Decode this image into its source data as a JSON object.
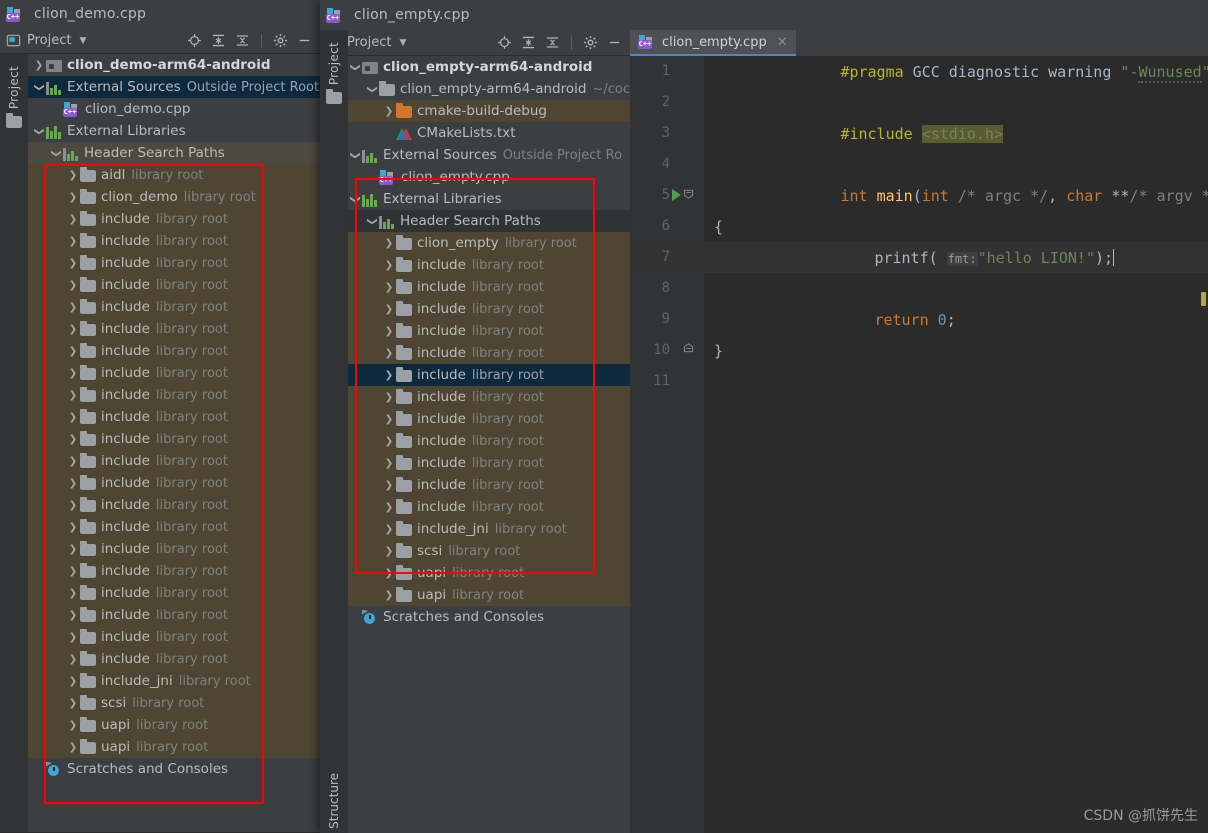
{
  "window_left": {
    "title": "clion_demo.cpp",
    "title_icon": "cpp-file-icon",
    "toolwindow": {
      "label": "Project",
      "caret_icon": "chevron-down-icon",
      "icons": [
        "locate-icon",
        "expand-all-icon",
        "collapse-all-icon",
        "gear-icon",
        "minimize-icon"
      ],
      "vertical_tab": "Project"
    },
    "tree": [
      {
        "indent": 0,
        "arrow": "chevron-right",
        "icon": "module-icon",
        "name": "clion_demo-arm64-android",
        "sub": "",
        "bold": true,
        "state": ""
      },
      {
        "indent": 0,
        "arrow": "chevron-down",
        "icon": "sources-icon",
        "name": "External Sources",
        "sub": "Outside Project Root",
        "bold": false,
        "state": "sel-blue"
      },
      {
        "indent": 1,
        "arrow": "none",
        "icon": "cpp-file-icon",
        "name": "clion_demo.cpp",
        "sub": "",
        "bold": false,
        "state": ""
      },
      {
        "indent": 0,
        "arrow": "chevron-down",
        "icon": "libs-icon",
        "name": "External Libraries",
        "sub": "",
        "bold": false,
        "state": ""
      },
      {
        "indent": 1,
        "arrow": "chevron-down",
        "icon": "sources-icon",
        "name": "Header Search Paths",
        "sub": "",
        "bold": false,
        "state": "hdr-sel"
      },
      {
        "indent": 2,
        "arrow": "chevron-right",
        "icon": "folder-icon",
        "name": "aidl",
        "sub": "library root",
        "bold": false,
        "state": "sel-olive"
      },
      {
        "indent": 2,
        "arrow": "chevron-right",
        "icon": "folder-icon",
        "name": "clion_demo",
        "sub": "library root",
        "bold": false,
        "state": "sel-olive"
      },
      {
        "indent": 2,
        "arrow": "chevron-right",
        "icon": "folder-icon",
        "name": "include",
        "sub": "library root",
        "bold": false,
        "state": "sel-olive"
      },
      {
        "indent": 2,
        "arrow": "chevron-right",
        "icon": "folder-icon",
        "name": "include",
        "sub": "library root",
        "bold": false,
        "state": "sel-olive"
      },
      {
        "indent": 2,
        "arrow": "chevron-right",
        "icon": "folder-icon",
        "name": "include",
        "sub": "library root",
        "bold": false,
        "state": "sel-olive"
      },
      {
        "indent": 2,
        "arrow": "chevron-right",
        "icon": "folder-icon",
        "name": "include",
        "sub": "library root",
        "bold": false,
        "state": "sel-olive"
      },
      {
        "indent": 2,
        "arrow": "chevron-right",
        "icon": "folder-icon",
        "name": "include",
        "sub": "library root",
        "bold": false,
        "state": "sel-olive"
      },
      {
        "indent": 2,
        "arrow": "chevron-right",
        "icon": "folder-icon",
        "name": "include",
        "sub": "library root",
        "bold": false,
        "state": "sel-olive"
      },
      {
        "indent": 2,
        "arrow": "chevron-right",
        "icon": "folder-icon",
        "name": "include",
        "sub": "library root",
        "bold": false,
        "state": "sel-olive"
      },
      {
        "indent": 2,
        "arrow": "chevron-right",
        "icon": "folder-icon",
        "name": "include",
        "sub": "library root",
        "bold": false,
        "state": "sel-olive"
      },
      {
        "indent": 2,
        "arrow": "chevron-right",
        "icon": "folder-icon",
        "name": "include",
        "sub": "library root",
        "bold": false,
        "state": "sel-olive"
      },
      {
        "indent": 2,
        "arrow": "chevron-right",
        "icon": "folder-icon",
        "name": "include",
        "sub": "library root",
        "bold": false,
        "state": "sel-olive"
      },
      {
        "indent": 2,
        "arrow": "chevron-right",
        "icon": "folder-icon",
        "name": "include",
        "sub": "library root",
        "bold": false,
        "state": "sel-olive"
      },
      {
        "indent": 2,
        "arrow": "chevron-right",
        "icon": "folder-icon",
        "name": "include",
        "sub": "library root",
        "bold": false,
        "state": "sel-olive"
      },
      {
        "indent": 2,
        "arrow": "chevron-right",
        "icon": "folder-icon",
        "name": "include",
        "sub": "library root",
        "bold": false,
        "state": "sel-olive"
      },
      {
        "indent": 2,
        "arrow": "chevron-right",
        "icon": "folder-icon",
        "name": "include",
        "sub": "library root",
        "bold": false,
        "state": "sel-olive"
      },
      {
        "indent": 2,
        "arrow": "chevron-right",
        "icon": "folder-icon",
        "name": "include",
        "sub": "library root",
        "bold": false,
        "state": "sel-olive"
      },
      {
        "indent": 2,
        "arrow": "chevron-right",
        "icon": "folder-icon",
        "name": "include",
        "sub": "library root",
        "bold": false,
        "state": "sel-olive"
      },
      {
        "indent": 2,
        "arrow": "chevron-right",
        "icon": "folder-icon",
        "name": "include",
        "sub": "library root",
        "bold": false,
        "state": "sel-olive"
      },
      {
        "indent": 2,
        "arrow": "chevron-right",
        "icon": "folder-icon",
        "name": "include",
        "sub": "library root",
        "bold": false,
        "state": "sel-olive"
      },
      {
        "indent": 2,
        "arrow": "chevron-right",
        "icon": "folder-icon",
        "name": "include",
        "sub": "library root",
        "bold": false,
        "state": "sel-olive"
      },
      {
        "indent": 2,
        "arrow": "chevron-right",
        "icon": "folder-icon",
        "name": "include",
        "sub": "library root",
        "bold": false,
        "state": "sel-olive"
      },
      {
        "indent": 2,
        "arrow": "chevron-right",
        "icon": "folder-icon",
        "name": "include",
        "sub": "library root",
        "bold": false,
        "state": "sel-olive"
      },
      {
        "indent": 2,
        "arrow": "chevron-right",
        "icon": "folder-icon",
        "name": "include_jni",
        "sub": "library root",
        "bold": false,
        "state": "sel-olive"
      },
      {
        "indent": 2,
        "arrow": "chevron-right",
        "icon": "folder-icon",
        "name": "scsi",
        "sub": "library root",
        "bold": false,
        "state": "sel-olive"
      },
      {
        "indent": 2,
        "arrow": "chevron-right",
        "icon": "folder-icon",
        "name": "uapi",
        "sub": "library root",
        "bold": false,
        "state": "sel-olive"
      },
      {
        "indent": 2,
        "arrow": "chevron-right",
        "icon": "folder-icon",
        "name": "uapi",
        "sub": "library root",
        "bold": false,
        "state": "sel-olive"
      },
      {
        "indent": 0,
        "arrow": "none",
        "icon": "scratches-icon",
        "name": "Scratches and Consoles",
        "sub": "",
        "bold": false,
        "state": ""
      }
    ],
    "highlight_box": {
      "label": "header-search-paths-highlight"
    }
  },
  "window_right": {
    "title": "clion_empty.cpp",
    "title_icon": "cpp-file-icon",
    "toolwindow": {
      "label": "Project",
      "caret_icon": "chevron-down-icon",
      "icons": [
        "locate-icon",
        "expand-all-icon",
        "collapse-all-icon",
        "gear-icon",
        "minimize-icon"
      ],
      "vertical_tab": "Project",
      "vertical_tab_bottom": "Structure"
    },
    "tree": [
      {
        "indent": 0,
        "arrow": "chevron-down",
        "icon": "module-icon",
        "name": "clion_empty-arm64-android",
        "sub": "",
        "bold": true,
        "state": ""
      },
      {
        "indent": 1,
        "arrow": "chevron-down",
        "icon": "folder-icon",
        "name": "clion_empty-arm64-android",
        "sub": "~/coc",
        "bold": false,
        "state": ""
      },
      {
        "indent": 2,
        "arrow": "chevron-right",
        "icon": "folder-orange-icon",
        "name": "cmake-build-debug",
        "sub": "",
        "bold": false,
        "state": "sel-olive"
      },
      {
        "indent": 2,
        "arrow": "none",
        "icon": "cmake-icon",
        "name": "CMakeLists.txt",
        "sub": "",
        "bold": false,
        "state": ""
      },
      {
        "indent": 0,
        "arrow": "chevron-down",
        "icon": "sources-icon",
        "name": "External Sources",
        "sub": "Outside Project Ro",
        "bold": false,
        "state": ""
      },
      {
        "indent": 1,
        "arrow": "none",
        "icon": "cpp-file-icon",
        "name": "clion_empty.cpp",
        "sub": "",
        "bold": false,
        "state": ""
      },
      {
        "indent": 0,
        "arrow": "chevron-down",
        "icon": "libs-icon",
        "name": "External Libraries",
        "sub": "",
        "bold": false,
        "state": ""
      },
      {
        "indent": 1,
        "arrow": "chevron-down",
        "icon": "sources-icon",
        "name": "Header Search Paths",
        "sub": "",
        "bold": false,
        "state": "sel-dark"
      },
      {
        "indent": 2,
        "arrow": "chevron-right",
        "icon": "folder-icon",
        "name": "clion_empty",
        "sub": "library root",
        "bold": false,
        "state": "sel-olive"
      },
      {
        "indent": 2,
        "arrow": "chevron-right",
        "icon": "folder-icon",
        "name": "include",
        "sub": "library root",
        "bold": false,
        "state": "sel-olive"
      },
      {
        "indent": 2,
        "arrow": "chevron-right",
        "icon": "folder-icon",
        "name": "include",
        "sub": "library root",
        "bold": false,
        "state": "sel-olive"
      },
      {
        "indent": 2,
        "arrow": "chevron-right",
        "icon": "folder-icon",
        "name": "include",
        "sub": "library root",
        "bold": false,
        "state": "sel-olive"
      },
      {
        "indent": 2,
        "arrow": "chevron-right",
        "icon": "folder-icon",
        "name": "include",
        "sub": "library root",
        "bold": false,
        "state": "sel-olive"
      },
      {
        "indent": 2,
        "arrow": "chevron-right",
        "icon": "folder-icon",
        "name": "include",
        "sub": "library root",
        "bold": false,
        "state": "sel-olive"
      },
      {
        "indent": 2,
        "arrow": "chevron-right",
        "icon": "folder-icon",
        "name": "include",
        "sub": "library root",
        "bold": false,
        "state": "sel-blue"
      },
      {
        "indent": 2,
        "arrow": "chevron-right",
        "icon": "folder-icon",
        "name": "include",
        "sub": "library root",
        "bold": false,
        "state": "sel-olive"
      },
      {
        "indent": 2,
        "arrow": "chevron-right",
        "icon": "folder-icon",
        "name": "include",
        "sub": "library root",
        "bold": false,
        "state": "sel-olive"
      },
      {
        "indent": 2,
        "arrow": "chevron-right",
        "icon": "folder-icon",
        "name": "include",
        "sub": "library root",
        "bold": false,
        "state": "sel-olive"
      },
      {
        "indent": 2,
        "arrow": "chevron-right",
        "icon": "folder-icon",
        "name": "include",
        "sub": "library root",
        "bold": false,
        "state": "sel-olive"
      },
      {
        "indent": 2,
        "arrow": "chevron-right",
        "icon": "folder-icon",
        "name": "include",
        "sub": "library root",
        "bold": false,
        "state": "sel-olive"
      },
      {
        "indent": 2,
        "arrow": "chevron-right",
        "icon": "folder-icon",
        "name": "include",
        "sub": "library root",
        "bold": false,
        "state": "sel-olive"
      },
      {
        "indent": 2,
        "arrow": "chevron-right",
        "icon": "folder-icon",
        "name": "include_jni",
        "sub": "library root",
        "bold": false,
        "state": "sel-olive"
      },
      {
        "indent": 2,
        "arrow": "chevron-right",
        "icon": "folder-icon",
        "name": "scsi",
        "sub": "library root",
        "bold": false,
        "state": "sel-olive"
      },
      {
        "indent": 2,
        "arrow": "chevron-right",
        "icon": "folder-icon",
        "name": "uapi",
        "sub": "library root",
        "bold": false,
        "state": "sel-olive"
      },
      {
        "indent": 2,
        "arrow": "chevron-right",
        "icon": "folder-icon",
        "name": "uapi",
        "sub": "library root",
        "bold": false,
        "state": "sel-olive"
      },
      {
        "indent": 0,
        "arrow": "none",
        "icon": "scratches-icon",
        "name": "Scratches and Consoles",
        "sub": "",
        "bold": false,
        "state": ""
      }
    ]
  },
  "editor": {
    "tab": {
      "label": "clion_empty.cpp",
      "icon": "cpp-file-icon",
      "close_icon": "close-icon",
      "active": true
    },
    "accent_color": "#4a88c7",
    "lines": [
      {
        "num": "1",
        "gutter_icon": "",
        "fold": "",
        "current": false
      },
      {
        "num": "2",
        "gutter_icon": "",
        "fold": "",
        "current": false
      },
      {
        "num": "3",
        "gutter_icon": "",
        "fold": "",
        "current": false
      },
      {
        "num": "4",
        "gutter_icon": "",
        "fold": "",
        "current": false
      },
      {
        "num": "5",
        "gutter_icon": "run-icon",
        "fold": "fold-open-icon",
        "current": false
      },
      {
        "num": "6",
        "gutter_icon": "",
        "fold": "",
        "current": false
      },
      {
        "num": "7",
        "gutter_icon": "",
        "fold": "",
        "current": true
      },
      {
        "num": "8",
        "gutter_icon": "",
        "fold": "",
        "current": false
      },
      {
        "num": "9",
        "gutter_icon": "",
        "fold": "",
        "current": false
      },
      {
        "num": "10",
        "gutter_icon": "",
        "fold": "fold-close-icon",
        "current": false
      },
      {
        "num": "11",
        "gutter_icon": "",
        "fold": "",
        "current": false
      }
    ],
    "code": {
      "l1_pragma": "#pragma",
      "l1_rest": " GCC diagnostic warning ",
      "l1_str_open": "\"-",
      "l1_str_wavy": "Wunused",
      "l1_str_close": "\"",
      "l3_include": "#include",
      "l3_header": "<stdio.h>",
      "l5_int": "int",
      "l5_space": " ",
      "l5_main": "main",
      "l5_paren": "(",
      "l5_int2": "int",
      "l5_cmt1": " /* argc */",
      "l5_comma": ", ",
      "l5_char": "char",
      "l5_stars": " **",
      "l5_cmt2": "/* argv */",
      "l5_close": ")",
      "l6_brace": "{",
      "l7_printf": "printf",
      "l7_open": "( ",
      "l7_hint": "fmt:",
      "l7_str": "\"hello LION!\"",
      "l7_end": ");",
      "l9_return": "return",
      "l9_num": " 0",
      "l9_semi": ";",
      "l10_brace": "}"
    }
  },
  "watermark": "CSDN @抓饼先生"
}
